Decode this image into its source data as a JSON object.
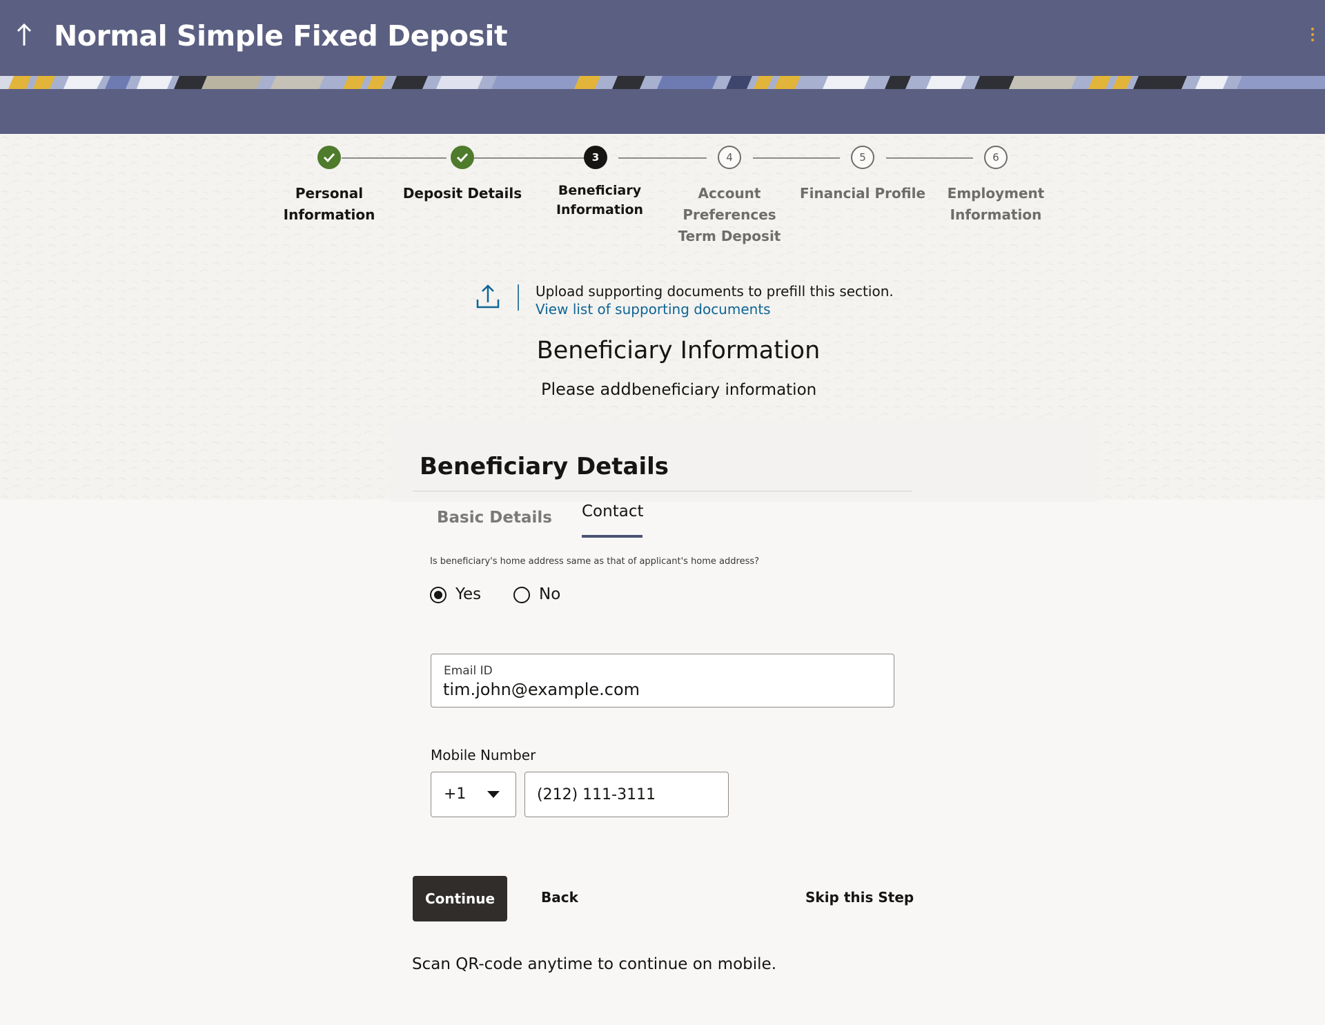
{
  "header": {
    "title": "Normal Simple Fixed Deposit",
    "colors": {
      "background": "#5b5f81",
      "title": "#ffffff",
      "menu_accent": "#e4a72c"
    }
  },
  "stepper": {
    "steps": [
      {
        "number": "1",
        "label": "Personal Information",
        "status": "completed"
      },
      {
        "number": "2",
        "label": "Deposit Details",
        "status": "completed"
      },
      {
        "number": "3",
        "label": "Beneficiary Information",
        "status": "current"
      },
      {
        "number": "4",
        "label": "Account Preferences Term Deposit",
        "status": "pending"
      },
      {
        "number": "5",
        "label": "Financial Profile",
        "status": "pending"
      },
      {
        "number": "6",
        "label": "Employment Information",
        "status": "pending"
      }
    ],
    "colors": {
      "completed": "#4f7b2c",
      "current": "#161513",
      "pending": "#6f6d6b"
    }
  },
  "upload": {
    "icon": "upload-icon",
    "text": "Upload supporting documents to prefill this section.",
    "link": "View list of supporting documents"
  },
  "section": {
    "title": "Beneficiary Information",
    "subtitle_prefix": "Please add",
    "subtitle_suffix": "beneficiary information"
  },
  "card": {
    "title": "Beneficiary Details",
    "tabs": [
      {
        "label": "Basic Details",
        "active": false
      },
      {
        "label": "Contact",
        "active": true
      }
    ]
  },
  "form": {
    "address_question": "Is beneficiary's home address same as that of applicant's home address?",
    "address_options": [
      {
        "label": "Yes",
        "selected": true
      },
      {
        "label": "No",
        "selected": false
      }
    ],
    "email": {
      "label": "Email ID",
      "value": "tim.john@example.com"
    },
    "mobile": {
      "label": "Mobile Number",
      "country_code": "+1",
      "number": "(212) 111-3111"
    }
  },
  "actions": {
    "continue": "Continue",
    "back": "Back",
    "skip": "Skip this Step"
  },
  "footer": {
    "qr_text": "Scan QR-code anytime to continue on mobile."
  }
}
